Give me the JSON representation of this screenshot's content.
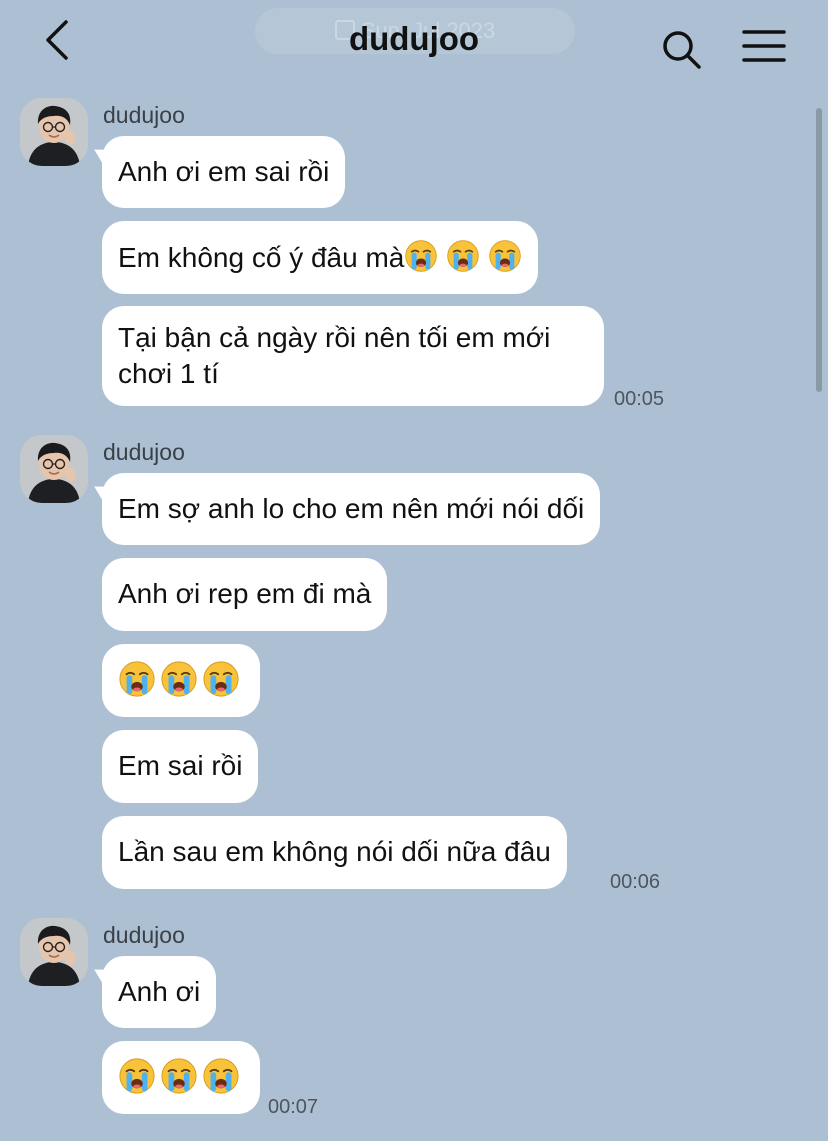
{
  "header": {
    "title": "dudujoo",
    "ghost_label": "Sun, Jul 2023"
  },
  "colors": {
    "background": "#adc0d3",
    "bubble": "#ffffff",
    "text": "#111111",
    "time": "#4d565f"
  },
  "groups": [
    {
      "sender": "dudujoo",
      "messages": [
        {
          "text": "Anh ơi em sai rồi"
        },
        {
          "text": "Em không cố ý đâu mà",
          "emoji": [
            "loudly-crying-face",
            "loudly-crying-face",
            "loudly-crying-face"
          ]
        },
        {
          "text": "Tại bận cả ngày rồi nên tối em mới chơi 1 tí"
        }
      ],
      "time": "00:05"
    },
    {
      "sender": "dudujoo",
      "messages": [
        {
          "text": "Em sợ anh lo cho em nên mới nói dối"
        },
        {
          "text": "Anh ơi rep em đi mà"
        },
        {
          "emoji": [
            "loudly-crying-face",
            "loudly-crying-face",
            "loudly-crying-face"
          ]
        },
        {
          "text": "Em sai rồi"
        },
        {
          "text": "Lần sau em không nói dối nữa đâu"
        }
      ],
      "time": "00:06"
    },
    {
      "sender": "dudujoo",
      "messages": [
        {
          "text": "Anh ơi"
        },
        {
          "emoji": [
            "loudly-crying-face",
            "loudly-crying-face",
            "loudly-crying-face"
          ]
        }
      ],
      "time": "00:07"
    }
  ]
}
